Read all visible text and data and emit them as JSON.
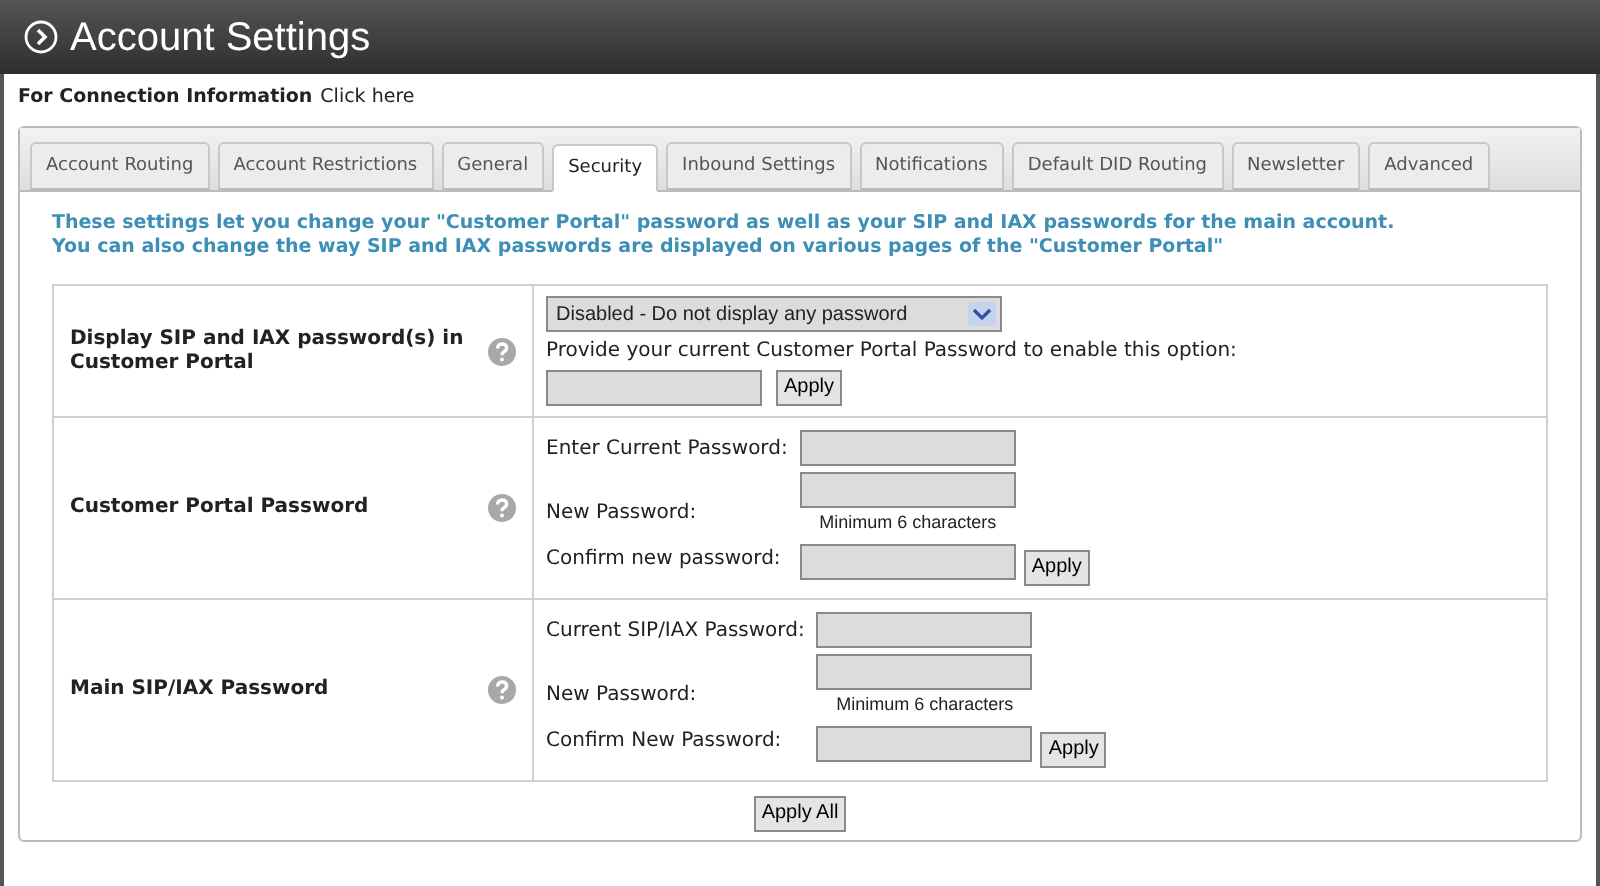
{
  "header": {
    "title": "Account Settings"
  },
  "connection_info": {
    "label": "For Connection Information",
    "link": "Click here"
  },
  "tabs": [
    {
      "label": "Account Routing",
      "selected": false
    },
    {
      "label": "Account Restrictions",
      "selected": false
    },
    {
      "label": "General",
      "selected": false
    },
    {
      "label": "Security",
      "selected": true
    },
    {
      "label": "Inbound Settings",
      "selected": false
    },
    {
      "label": "Notifications",
      "selected": false
    },
    {
      "label": "Default DID Routing",
      "selected": false
    },
    {
      "label": "Newsletter",
      "selected": false
    },
    {
      "label": "Advanced",
      "selected": false
    }
  ],
  "intro": [
    "These settings let you change your \"Customer Portal\" password as well as your SIP and IAX passwords for the main account.",
    "You can also change the way SIP and IAX passwords are displayed on various pages of the \"Customer Portal\""
  ],
  "sections": [
    {
      "label": "Display SIP and IAX password(s) in Customer Portal",
      "kind": "select",
      "select_value": "Disabled - Do not display any password",
      "prompt": "Provide your current Customer Portal Password to enable this option:",
      "button": "Apply"
    },
    {
      "label": "Customer Portal Password",
      "kind": "form",
      "fields": [
        {
          "label": "Enter Current Password:"
        },
        {
          "label": "New Password:",
          "hint": "Minimum 6 characters"
        },
        {
          "label": "Confirm new password:"
        }
      ],
      "button": "Apply"
    },
    {
      "label": "Main SIP/IAX Password",
      "kind": "form",
      "fields": [
        {
          "label": "Current SIP/IAX Password:"
        },
        {
          "label": "New Password:",
          "hint": "Minimum 6 characters"
        },
        {
          "label": "Confirm New Password:"
        }
      ],
      "button": "Apply"
    }
  ],
  "apply_all": "Apply All"
}
